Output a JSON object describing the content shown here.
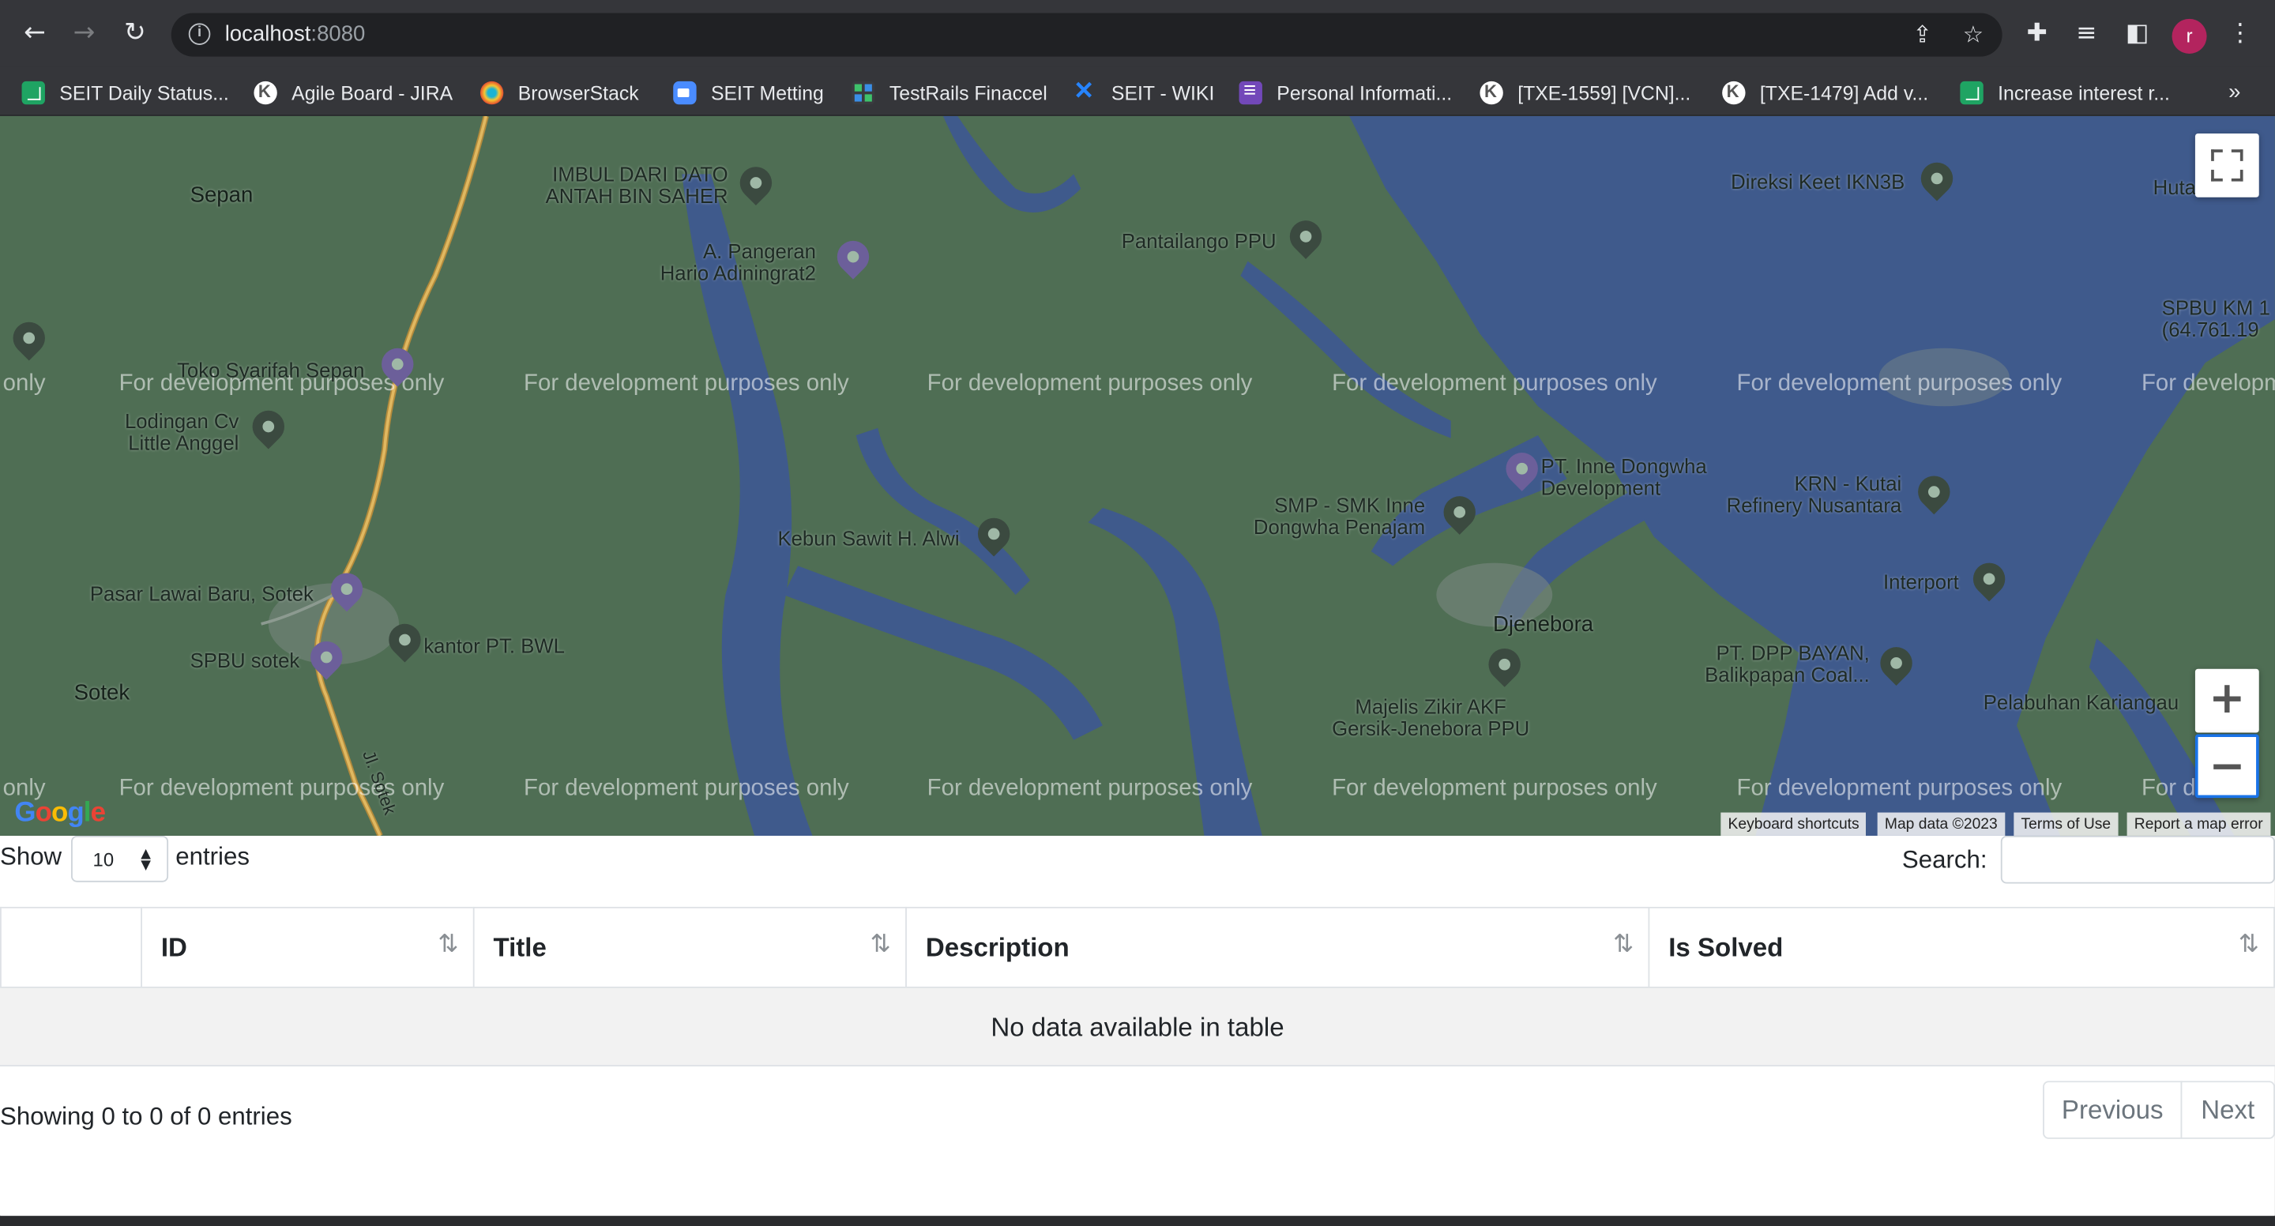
{
  "browser": {
    "url_host": "localhost",
    "url_port": ":8080",
    "profile_initial": "r",
    "bookmarks": [
      {
        "label": "SEIT Daily Status...",
        "icon": "sheets-icon"
      },
      {
        "label": "Agile Board - JIRA",
        "icon": "kanban-icon"
      },
      {
        "label": "BrowserStack",
        "icon": "browserstack-icon"
      },
      {
        "label": "SEIT Metting",
        "icon": "zoom-icon"
      },
      {
        "label": "TestRails Finaccel",
        "icon": "testrail-icon"
      },
      {
        "label": "SEIT - WIKI",
        "icon": "confluence-icon"
      },
      {
        "label": "Personal Informati...",
        "icon": "forms-icon"
      },
      {
        "label": "[TXE-1559] [VCN]...",
        "icon": "kanban-icon"
      },
      {
        "label": "[TXE-1479] Add v...",
        "icon": "kanban-icon"
      },
      {
        "label": "Increase interest r...",
        "icon": "sheets-icon"
      }
    ],
    "bookmarks_overflow": "»"
  },
  "map": {
    "watermark": "For development purposes only",
    "watermark_partial_left": "only",
    "watermark_partial_right_1": "For developm",
    "watermark_partial_right_2": "For d",
    "places": {
      "sepan": "Sepan",
      "imbul": "IMBUL DARI DATO\nANTAH BIN SAHER",
      "pangeran": "A. Pangeran\nHario Adiningrat2",
      "pantailango": "Pantailango PPU",
      "direksi": "Direksi Keet IKN3B",
      "huta": "Huta",
      "spbu_km": "SPBU KM 1\n(64.761.19",
      "toko": "Toko Syarifah Sepan",
      "lodingan": "Lodingan Cv\nLittle Anggel",
      "kebun": "Kebun Sawit H. Alwi",
      "inne": "PT. Inne Dongwha\nDevelopment",
      "smp": "SMP - SMK Inne\nDongwha Penajam",
      "krn": "KRN - Kutai\nRefinery Nusantara",
      "interport": "Interport",
      "pasar": "Pasar Lawai Baru, Sotek",
      "kantor": "kantor PT. BWL",
      "spbu_sotek": "SPBU sotek",
      "sotek": "Sotek",
      "djenebora": "Djenebora",
      "dpp": "PT. DPP BAYAN,\nBalikpapan Coal...",
      "majelis": "Majelis Zikir AKF\nGersik-Jenebora PPU",
      "pelabuhan": "Pelabuhan Kariangau",
      "jl": "Jl. Sotek"
    },
    "zoom_in": "+",
    "zoom_out": "−",
    "logo": "Google",
    "attribution": [
      "Keyboard shortcuts",
      "Map data ©2023",
      "Terms of Use",
      "Report a map error"
    ]
  },
  "table": {
    "show_label": "Show",
    "length_value": "10",
    "entries_label": "entries",
    "search_label": "Search:",
    "search_value": "",
    "columns": [
      "",
      "ID",
      "Title",
      "Description",
      "Is Solved"
    ],
    "empty_message": "No data available in table",
    "info": "Showing 0 to 0 of 0 entries",
    "prev_label": "Previous",
    "next_label": "Next"
  }
}
